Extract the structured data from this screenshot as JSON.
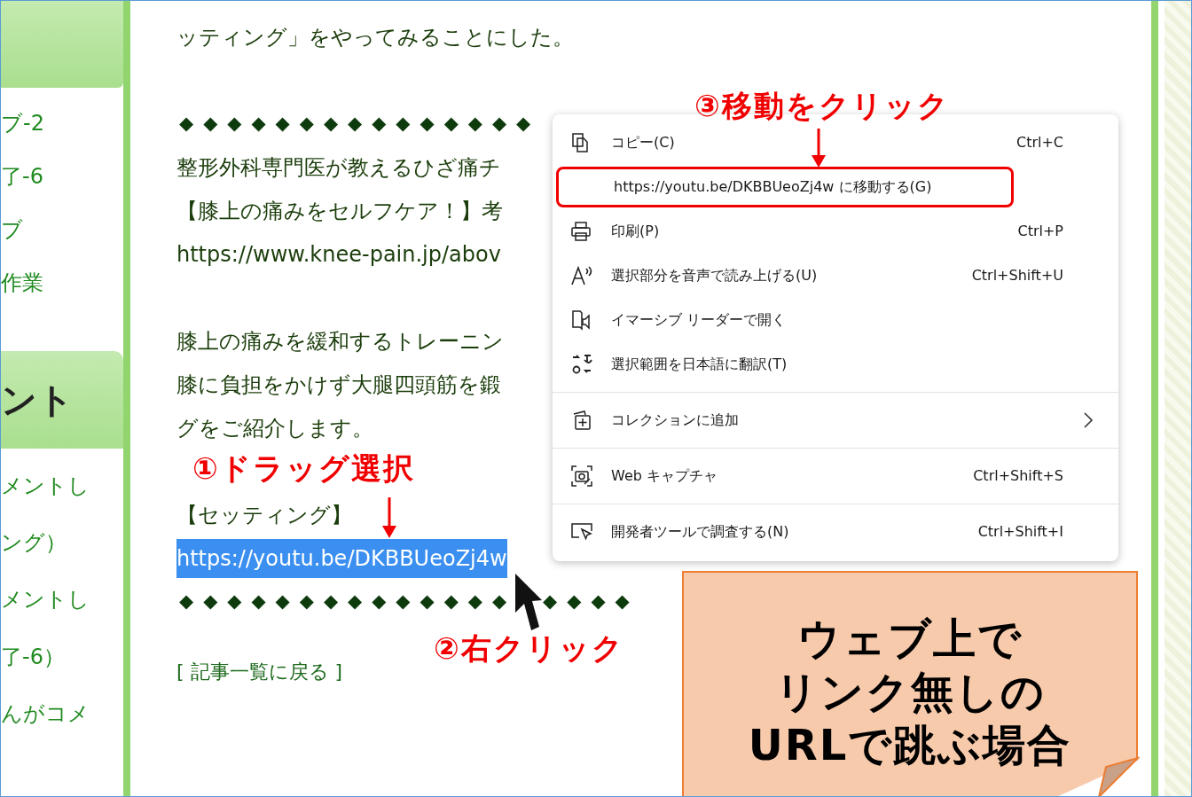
{
  "sidebar": {
    "items": [
      {
        "kind": "link",
        "text": "ブ-2"
      },
      {
        "kind": "link",
        "text": "了-6"
      },
      {
        "kind": "link",
        "text": "ブ"
      },
      {
        "kind": "link",
        "text": "作業"
      },
      {
        "kind": "heading",
        "text": "ント"
      },
      {
        "kind": "link",
        "text": "メントし"
      },
      {
        "kind": "link",
        "text": "ング）"
      },
      {
        "kind": "link",
        "text": "メントし"
      },
      {
        "kind": "link",
        "text": "了-6）"
      },
      {
        "kind": "link",
        "text": "んがコメ"
      }
    ]
  },
  "article": {
    "blocks": [
      {
        "kind": "text",
        "text": "ッティング」をやってみることにした。"
      },
      {
        "kind": "gap"
      },
      {
        "kind": "diamonds",
        "parts": [
          "◆◆◆◆◆◆◆◆◆◆◆◆◆◆◆"
        ]
      },
      {
        "kind": "text",
        "text": "整形外科専門医が教えるひざ痛チ"
      },
      {
        "kind": "text",
        "text": "【膝上の痛みをセルフケア！】考"
      },
      {
        "kind": "text",
        "text": "https://www.knee-pain.jp/abov"
      },
      {
        "kind": "gap"
      },
      {
        "kind": "text",
        "text": "膝上の痛みを緩和するトレーニン"
      },
      {
        "kind": "text",
        "text": "膝に負担をかけず大腿四頭筋を鍛"
      },
      {
        "kind": "text",
        "text": "グをご紹介します。"
      },
      {
        "kind": "gap"
      },
      {
        "kind": "text",
        "text": "【セッティング】"
      },
      {
        "kind": "selected",
        "text": "https://youtu.be/DKBBUeoZj4w"
      },
      {
        "kind": "diamonds",
        "parts": [
          "◆◆◆◆◆◆◆◆◆◆◆◆◆◆",
          "◆◆◆◆"
        ]
      },
      {
        "kind": "small_gap"
      },
      {
        "kind": "link",
        "text": "[ 記事一覧に戻る ]"
      }
    ]
  },
  "context_menu": {
    "groups": [
      {
        "items": [
          {
            "label": "コピー(C)",
            "shortcut": "Ctrl+C",
            "submenu": false,
            "selected": false
          },
          {
            "label": "https://youtu.be/DKBBUeoZj4w に移動する(G)",
            "submenu": false,
            "selected": true
          },
          {
            "label": "印刷(P)",
            "shortcut": "Ctrl+P",
            "submenu": false,
            "selected": false
          },
          {
            "label": "選択部分を音声で読み上げる(U)",
            "shortcut": "Ctrl+Shift+U",
            "submenu": false,
            "selected": false
          },
          {
            "label": "イマーシブ リーダーで開く",
            "submenu": false,
            "selected": false
          },
          {
            "label": "選択範囲を日本語に翻訳(T)",
            "submenu": false,
            "selected": false
          }
        ]
      },
      {
        "items": [
          {
            "label": "コレクションに追加",
            "submenu": true,
            "selected": false
          }
        ]
      },
      {
        "items": [
          {
            "label": "Web キャプチャ",
            "shortcut": "Ctrl+Shift+S",
            "submenu": false,
            "selected": false
          }
        ]
      },
      {
        "items": [
          {
            "label": "開発者ツールで調査する(N)",
            "shortcut": "Ctrl+Shift+I",
            "submenu": false,
            "selected": false
          }
        ]
      }
    ]
  },
  "annotations": [
    {
      "text": "①ドラッグ選択"
    },
    {
      "text": "②右クリック"
    },
    {
      "text": "③移動をクリック"
    }
  ],
  "note": {
    "lines": [
      "ウェブ上で",
      "リンク無しの",
      "URLで跳ぶ場合"
    ]
  }
}
